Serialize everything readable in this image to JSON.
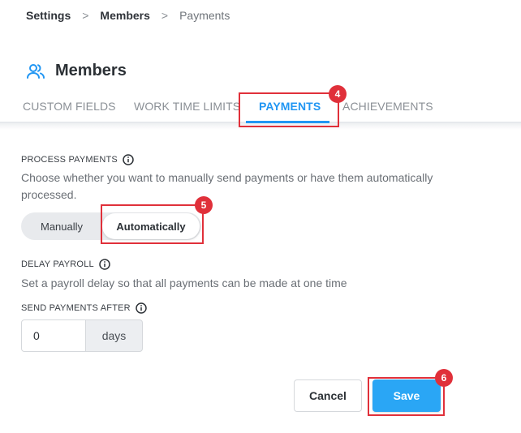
{
  "breadcrumb": {
    "items": [
      "Settings",
      "Members",
      "Payments"
    ],
    "separator": ">"
  },
  "page": {
    "title": "Members",
    "icon": "users-icon"
  },
  "tabs": [
    {
      "label": "CUSTOM FIELDS",
      "active": false
    },
    {
      "label": "WORK TIME LIMITS",
      "active": false
    },
    {
      "label": "PAYMENTS",
      "active": true
    },
    {
      "label": "ACHIEVEMENTS",
      "active": false
    }
  ],
  "process_payments": {
    "label": "PROCESS PAYMENTS",
    "description": "Choose whether you want to manually send payments or have them automatically processed.",
    "options": [
      "Manually",
      "Automatically"
    ],
    "selected": "Automatically"
  },
  "delay_payroll": {
    "label": "DELAY PAYROLL",
    "description": "Set a payroll delay so that all payments can be made at one time"
  },
  "send_after": {
    "label": "SEND PAYMENTS AFTER",
    "value": "0",
    "unit": "days"
  },
  "actions": {
    "cancel_label": "Cancel",
    "save_label": "Save"
  },
  "annotations": [
    {
      "number": "4",
      "target": "PAYMENTS tab"
    },
    {
      "number": "5",
      "target": "Automatically option"
    },
    {
      "number": "6",
      "target": "Save button"
    }
  ],
  "colors": {
    "accent": "#2196f3",
    "save_button": "#2aa6f5",
    "annotation": "#e0303a"
  }
}
